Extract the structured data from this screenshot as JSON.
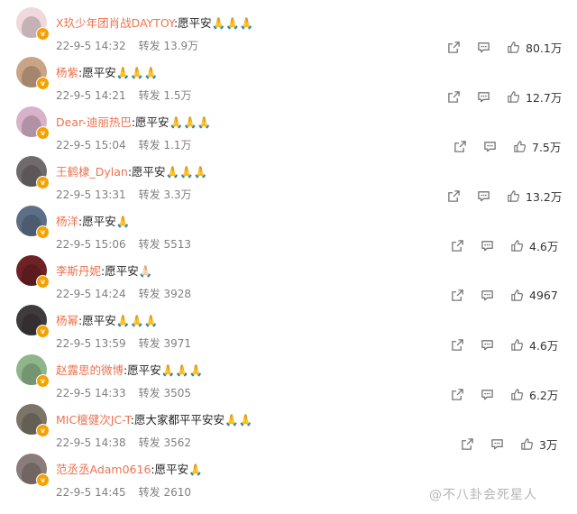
{
  "comments": [
    {
      "author": "X玖少年团肖战DAYTOY",
      "text": ":愿平安🙏🙏🙏",
      "date": "22-9-5 14:32",
      "repost_label": "转发",
      "reposts": "13.9万",
      "likes": "80.1万",
      "avatar_color": "#f0d9dc"
    },
    {
      "author": "杨紫",
      "text": ":愿平安🙏🙏🙏",
      "date": "22-9-5 14:21",
      "repost_label": "转发",
      "reposts": "1.5万",
      "likes": "12.7万",
      "avatar_color": "#c9a487"
    },
    {
      "author": "Dear-迪丽热巴",
      "text": ":愿平安🙏🙏🙏",
      "date": "22-9-5 15:04",
      "repost_label": "转发",
      "reposts": "1.1万",
      "likes": "7.5万",
      "avatar_color": "#d8b2c9"
    },
    {
      "author": "王鹤棣_Dylan",
      "text": ":愿平安🙏🙏🙏",
      "date": "22-9-5 13:31",
      "repost_label": "转发",
      "reposts": "3.3万",
      "likes": "13.2万",
      "avatar_color": "#6f6a6c"
    },
    {
      "author": "杨洋",
      "text": ":愿平安🙏",
      "date": "22-9-5 15:06",
      "repost_label": "转发",
      "reposts": "5513",
      "likes": "4.6万",
      "avatar_color": "#5d6f86"
    },
    {
      "author": "李斯丹妮",
      "text": ":愿平安🙏🏻",
      "date": "22-9-5 14:24",
      "repost_label": "转发",
      "reposts": "3928",
      "likes": "4967",
      "avatar_color": "#6e2226"
    },
    {
      "author": "杨幂",
      "text": ":愿平安🙏🙏🙏",
      "date": "22-9-5 13:59",
      "repost_label": "转发",
      "reposts": "3971",
      "likes": "4.6万",
      "avatar_color": "#3f3a3c"
    },
    {
      "author": "赵露思的微博",
      "text": ":愿平安🙏🙏🙏",
      "date": "22-9-5 14:33",
      "repost_label": "转发",
      "reposts": "3505",
      "likes": "6.2万",
      "avatar_color": "#8fb58a"
    },
    {
      "author": "MIC檀健次JC-T",
      "text": ":愿大家都平平安安🙏🙏",
      "date": "22-9-5 14:38",
      "repost_label": "转发",
      "reposts": "3562",
      "likes": "3万",
      "avatar_color": "#7b7468"
    },
    {
      "author": "范丞丞Adam0616",
      "text": ":愿平安🙏",
      "date": "22-9-5 14:45",
      "repost_label": "转发",
      "reposts": "2610",
      "likes": "",
      "avatar_color": "#8a7c7a"
    }
  ],
  "verified_badge": "v",
  "watermark": "@不八卦会死星人",
  "icons": {
    "repost": "share-icon",
    "comment": "comment-icon",
    "like": "thumbs-up-icon"
  }
}
